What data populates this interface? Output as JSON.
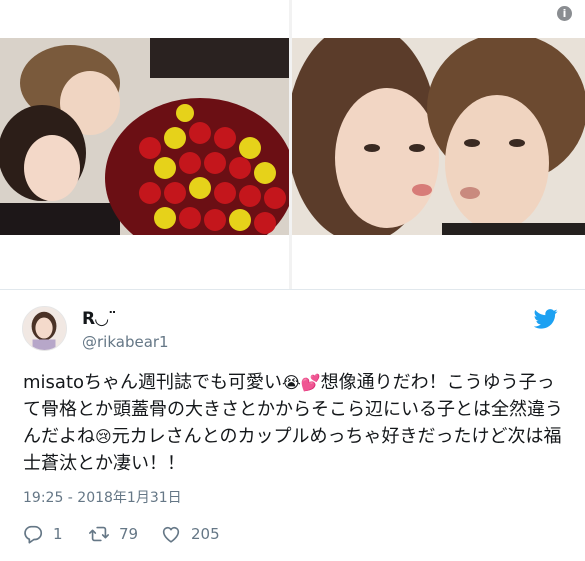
{
  "media": {
    "images": [
      {
        "icon": "couple-with-roses-photo"
      },
      {
        "icon": "couple-cheek-to-cheek-photo"
      }
    ],
    "info_icon": {
      "label": "i",
      "icon": "info-icon"
    }
  },
  "tweet": {
    "author": {
      "display_name": "R◡¨",
      "handle": "@rikabear1",
      "avatar_icon": "avatar"
    },
    "brand_icon": "twitter-bird-icon",
    "text_segments": [
      "misatoちゃん週刊誌でも可愛い",
      "😭💕",
      "想像通りだわ！こうゆう子って骨格とか頭蓋骨の大きさとかからそこら辺にいる子とは全然違うんだよね",
      "😢",
      "元カレさんとのカップルめっちゃ好きだったけど次は福士蒼汰とか凄い！！"
    ],
    "timestamp": "19:25 - 2018年1月31日",
    "actions": {
      "reply_count": "1",
      "retweet_count": "79",
      "like_count": "205"
    }
  },
  "colors": {
    "twitter_blue": "#1da1f2",
    "secondary_text": "#657786",
    "primary_text": "#14171a"
  }
}
